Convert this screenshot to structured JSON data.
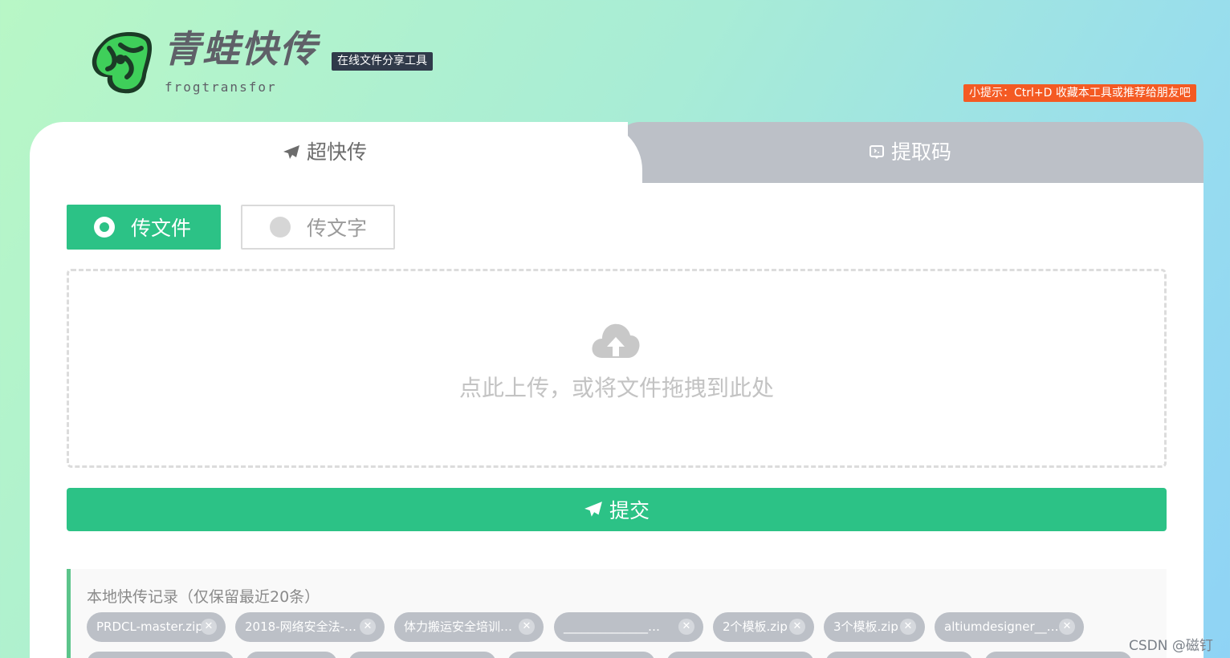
{
  "header": {
    "brand_title": "青蛙快传",
    "brand_sub": "frogtransfor",
    "slogan": "在线文件分享工具",
    "tip": "小提示：Ctrl+D 收藏本工具或推荐给朋友吧"
  },
  "tabs": [
    {
      "label": "超快传",
      "active": true
    },
    {
      "label": "提取码",
      "active": false
    }
  ],
  "mode": {
    "file_label": "传文件",
    "text_label": "传文字",
    "selected": "file"
  },
  "dropzone": {
    "text": "点此上传，或将文件拖拽到此处"
  },
  "submit_label": "提交",
  "history": {
    "title": "本地快传记录（仅保留最近20条）",
    "items": [
      "PRDCL-master.zip",
      "2018-网络安全法-…",
      "体力搬运安全培训…",
      "______________…",
      "2个模板.zip",
      "3个模板.zip",
      "altiumdesigner__…"
    ]
  },
  "watermark": "CSDN @磁钉",
  "colors": {
    "accent": "#2cc286",
    "tab_inactive": "#bcc0c7",
    "tip_bg": "#f45a23",
    "slogan_bg": "#303a4a"
  }
}
